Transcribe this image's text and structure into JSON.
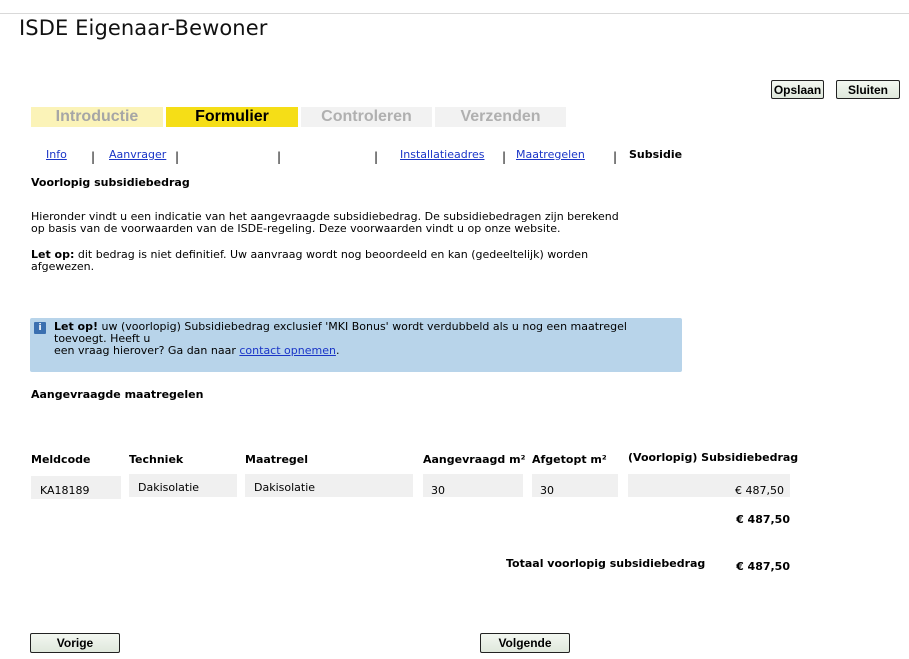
{
  "app": {
    "title": "ISDE Eigenaar-Bewoner"
  },
  "toolbar": {
    "save_label": "Opslaan",
    "close_label": "Sluiten"
  },
  "steps": [
    {
      "label": "Introductie",
      "state": "done"
    },
    {
      "label": "Formulier",
      "state": "active"
    },
    {
      "label": "Controleren",
      "state": "pending"
    },
    {
      "label": "Verzenden",
      "state": "pending"
    }
  ],
  "subnav": {
    "items": [
      "Info",
      "Aanvrager",
      "Installatieadres",
      "Maatregelen"
    ],
    "current": "Subsidie"
  },
  "section": {
    "heading": "Voorlopig subsidiebedrag",
    "intro_line1": "Hieronder vindt u een indicatie van het aangevraagde subsidiebedrag. De subsidiebedragen zijn berekend",
    "intro_line2": "op basis van de voorwaarden van de ISDE-regeling. Deze voorwaarden vindt u op onze website.",
    "note_label": "Let op:",
    "note_line1": " dit bedrag is niet definitief. Uw aanvraag wordt nog beoordeeld en kan (gedeeltelijk) worden",
    "note_line2": "afgewezen."
  },
  "info": {
    "bold": "Let op!",
    "text1": " uw (voorlopig) Subsidiebedrag exclusief 'MKI Bonus' wordt verdubbeld als u nog een maatregel toevoegt. Heeft u",
    "text2": "een vraag hierover? Ga dan naar ",
    "link": "contact opnemen",
    "text3": "."
  },
  "measures": {
    "heading": "Aangevraagde maatregelen",
    "columns": [
      "Meldcode",
      "Techniek",
      "Maatregel",
      "Aangevraagd m²",
      "Afgetopt m²",
      "(Voorlopig) Subsidiebedrag"
    ],
    "row": {
      "meldcode": "KA18189",
      "techniek": "Dakisolatie",
      "maatregel": "Dakisolatie",
      "aangevraagd": "30",
      "afgetopt": "30",
      "bedrag": "€ 487,50"
    },
    "subtotal": "€ 487,50"
  },
  "total": {
    "label": "Totaal voorlopig subsidiebedrag",
    "value": "€ 487,50"
  },
  "footer": {
    "prev_label": "Vorige",
    "next_label": "Volgende"
  }
}
